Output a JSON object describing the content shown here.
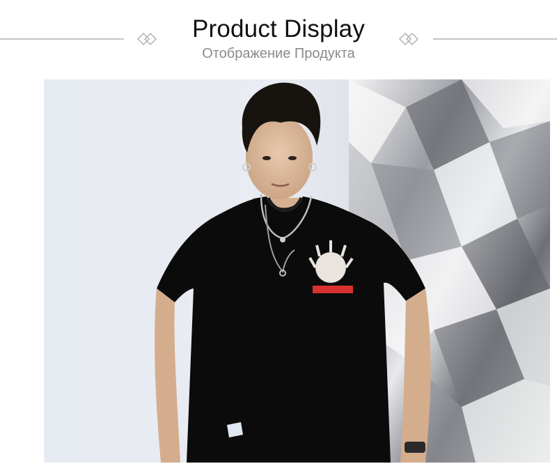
{
  "header": {
    "title": "Product Display",
    "subtitle": "Отображение Продукта",
    "decoration_icon": "double-diamond-icon",
    "rule_color": "#c4c4c4"
  },
  "photo": {
    "subject": "product-photo",
    "shirt_color": "#0a0a0a",
    "backdrop_color": "#e7eaf0"
  }
}
